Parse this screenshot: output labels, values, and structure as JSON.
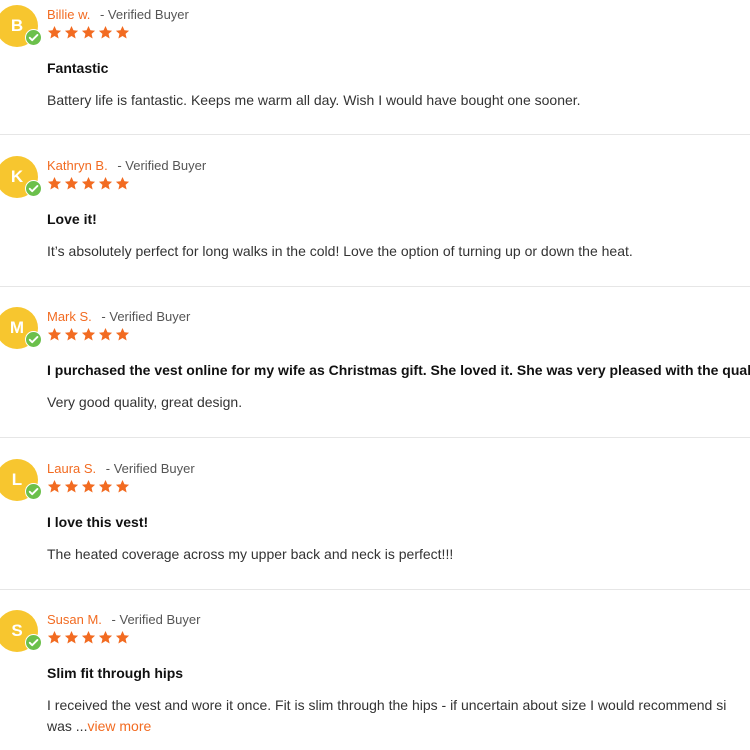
{
  "verified_label": "- Verified Buyer",
  "colors": {
    "accent": "#f26b21",
    "avatar": "#f7c62f",
    "badge": "#6bc04b",
    "star": "#f26b21"
  },
  "icons": {
    "star": "star-icon",
    "badge": "check-badge-icon"
  },
  "reviews": [
    {
      "initial": "B",
      "author": "Billie w.",
      "rating": 5,
      "title": "Fantastic",
      "body": "Battery life is fantastic. Keeps me warm all day. Wish I would have bought one sooner."
    },
    {
      "initial": "K",
      "author": "Kathryn B.",
      "rating": 5,
      "title": "Love it!",
      "body": "It’s absolutely perfect for long walks in the cold! Love the option of turning up or down the heat."
    },
    {
      "initial": "M",
      "author": "Mark S.",
      "rating": 5,
      "title": "I purchased the vest online for my wife as Christmas gift. She loved it. She was very pleased with the quality ar",
      "body": "Very good quality, great design."
    },
    {
      "initial": "L",
      "author": "Laura S.",
      "rating": 5,
      "title": "I love this vest!",
      "body": "The heated coverage across my upper back and neck is perfect!!!"
    },
    {
      "initial": "S",
      "author": "Susan M.",
      "rating": 5,
      "title": "Slim fit through hips",
      "body_line1": "I received the vest and wore it once. Fit is slim through the hips - if uncertain about size I would recommend si",
      "body_line2": "was ...",
      "view_more": "view more"
    }
  ]
}
